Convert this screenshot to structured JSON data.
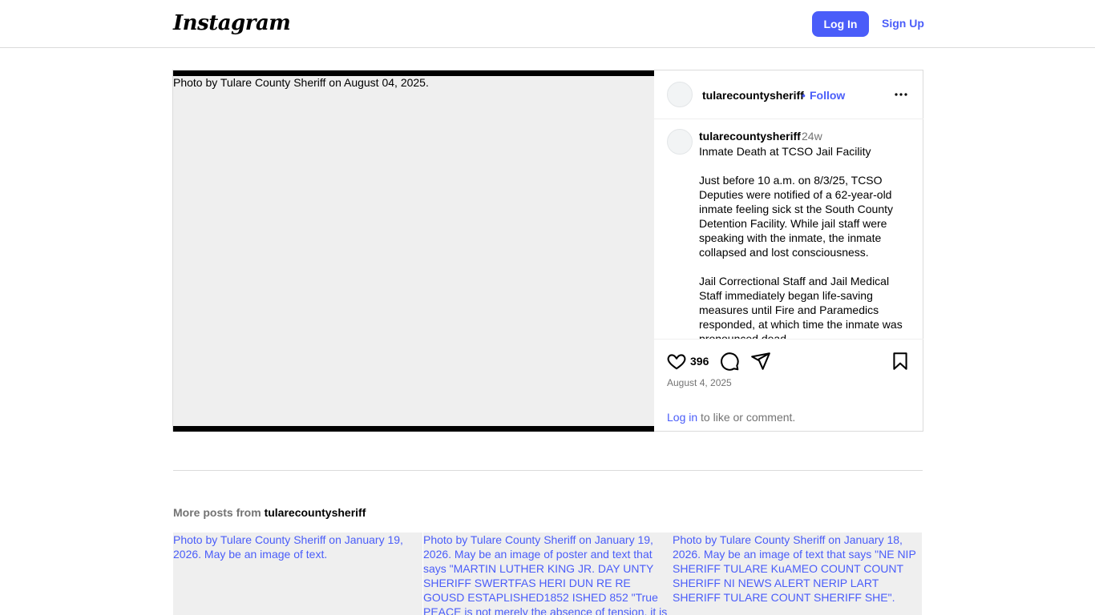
{
  "header": {
    "logo_text": "Instagram",
    "login_label": "Log In",
    "signup_label": "Sign Up"
  },
  "post": {
    "media_alt": "Photo by Tulare County Sheriff on August 04, 2025.",
    "username": "tularecountysheriff",
    "dot": "•",
    "follow_label": "Follow",
    "caption_username": "tularecountysheriff",
    "caption_time": "24w",
    "caption_paragraphs": [
      "Inmate Death at TCSO Jail Facility",
      "Just before 10 a.m. on 8/3/25, TCSO Deputies were notified of a 62-year-old inmate feeling sick st the South County Detention Facility. While jail staff were speaking with the inmate, the inmate collapsed and lost consciousness.",
      "Jail Correctional Staff and Jail Medical Staff immediately began life-saving measures until Fire and Paramedics responded, at which time the inmate was pronounced dead."
    ],
    "likes": "396",
    "date": "August 4, 2025",
    "login_link": "Log in",
    "login_suffix": " to like or comment."
  },
  "more_posts": {
    "label_prefix": "More posts from ",
    "username": "tularecountysheriff",
    "tiles": [
      {
        "alt": "Photo by Tulare County Sheriff on January 19, 2026. May be an image of text."
      },
      {
        "alt": "Photo by Tulare County Sheriff on January 19, 2026. May be an image of poster and text that says \"MARTIN LUTHER KING JR. DAY UNTY SHERIFF SWERTFAS HERI DUN RE RE GOUSD ESTAPLISHED1852 ISHED 852 \"True PEACE is not merely the absence of tension, it is the presence"
      },
      {
        "alt": "Photo by Tulare County Sheriff on January 18, 2026. May be an image of text that says \"NE NIP SHERIFF TULARE KuAMEO COUNT COUNT SHERIFF NI NEWS ALERT NERIP LART SHERIFF TULARE COUNT SHERIFF SHE\"."
      }
    ]
  },
  "icons": {
    "more": "more-horizontal-icon",
    "like": "heart-icon",
    "comment": "comment-icon",
    "share": "share-icon",
    "save": "bookmark-icon"
  },
  "colors": {
    "accent": "#4a5df9",
    "muted": "#737373",
    "border": "#dbdbdb",
    "placeholder": "#efefef"
  }
}
